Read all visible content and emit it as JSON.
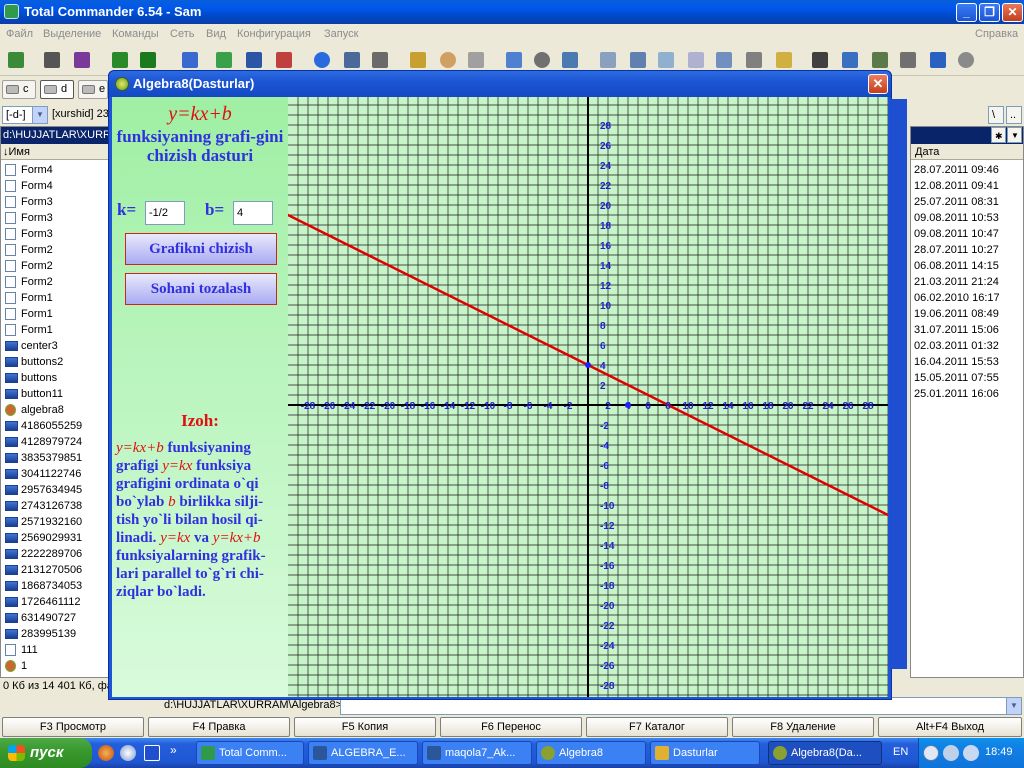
{
  "tc": {
    "title": "Total Commander 6.54 - Sam",
    "menu": [
      "Файл",
      "Выделение",
      "Команды",
      "Сеть",
      "Вид",
      "Конфигурация",
      "Запуск"
    ],
    "menu_right": "Справка",
    "drives_left": [
      "c",
      "d",
      "e"
    ],
    "drive_combo": "[-d-]",
    "drive_label": "[xurshid]  23",
    "left_path": "d:\\HUJJATLAR\\XURRA",
    "left_col_name": "↓Имя",
    "files": [
      {
        "name": "Form4",
        "icon": "file-icon"
      },
      {
        "name": "Form4",
        "icon": "file-icon"
      },
      {
        "name": "Form3",
        "icon": "file-icon"
      },
      {
        "name": "Form3",
        "icon": "file-icon"
      },
      {
        "name": "Form3",
        "icon": "file-icon"
      },
      {
        "name": "Form2",
        "icon": "file-icon"
      },
      {
        "name": "Form2",
        "icon": "file-icon"
      },
      {
        "name": "Form2",
        "icon": "file-icon"
      },
      {
        "name": "Form1",
        "icon": "file-icon"
      },
      {
        "name": "Form1",
        "icon": "file-icon"
      },
      {
        "name": "Form1",
        "icon": "file-icon"
      },
      {
        "name": "center3",
        "icon": "exe-icon"
      },
      {
        "name": "buttons2",
        "icon": "exe-icon"
      },
      {
        "name": "buttons",
        "icon": "exe-icon"
      },
      {
        "name": "button11",
        "icon": "exe-icon"
      },
      {
        "name": "algebra8",
        "icon": "gear-icon"
      },
      {
        "name": "4186055259",
        "icon": "exe-icon"
      },
      {
        "name": "4128979724",
        "icon": "exe-icon"
      },
      {
        "name": "3835379851",
        "icon": "exe-icon"
      },
      {
        "name": "3041122746",
        "icon": "exe-icon"
      },
      {
        "name": "2957634945",
        "icon": "exe-icon"
      },
      {
        "name": "2743126738",
        "icon": "exe-icon"
      },
      {
        "name": "2571932160",
        "icon": "exe-icon"
      },
      {
        "name": "2569029931",
        "icon": "exe-icon"
      },
      {
        "name": "2222289706",
        "icon": "exe-icon"
      },
      {
        "name": "2131270506",
        "icon": "exe-icon"
      },
      {
        "name": "1868734053",
        "icon": "exe-icon"
      },
      {
        "name": "1726461112",
        "icon": "exe-icon"
      },
      {
        "name": "631490727",
        "icon": "exe-icon"
      },
      {
        "name": "283995139",
        "icon": "exe-icon"
      },
      {
        "name": "111",
        "icon": "file-icon"
      },
      {
        "name": "1",
        "icon": "gear-icon"
      }
    ],
    "left_status": "0 Кб из 14 401 Кб, фа",
    "right_col_date": "Дата",
    "dates": [
      "28.07.2011 09:46",
      "12.08.2011 09:41",
      "25.07.2011 08:31",
      "09.08.2011 10:53",
      "09.08.2011 10:47",
      "28.07.2011 10:27",
      "06.08.2011 14:15",
      "21.03.2011 21:24",
      "06.02.2010 16:17",
      "19.06.2011 08:49",
      "31.07.2011 15:06",
      "02.03.2011 01:32",
      "16.04.2011 15:53",
      "15.05.2011 07:55",
      "25.01.2011 16:06"
    ],
    "cmd_path": "d:\\HUJJATLAR\\XURRAM\\Algebra8>",
    "fkeys": [
      "F3 Просмотр",
      "F4 Правка",
      "F5 Копия",
      "F6 Перенос",
      "F7 Каталог",
      "F8 Удаление",
      "Alt+F4 Выход"
    ]
  },
  "dialog": {
    "title": "Algebra8(Dasturlar)",
    "formula": "y=kx+b",
    "subtitle": "funksiyaning grafi-gini chizish dasturi",
    "k_label": "k=",
    "k_value": "-1/2",
    "b_label": "b=",
    "b_value": "4",
    "draw_button": "Grafikni chizish",
    "clear_button": "Sohani tozalash",
    "izoh": "Izoh:",
    "note": [
      {
        "t": "y=kx+b",
        "red": true
      },
      {
        "t": "  funksiyaning grafigi  ",
        "red": false
      },
      {
        "t": "y=kx",
        "red": true
      },
      {
        "t": "  funksiya grafigini ordinata o`qi bo`ylab ",
        "red": false
      },
      {
        "t": "b",
        "red": true
      },
      {
        "t": " birlikka silji-tish yo`li bilan hosil qi-linadi.  ",
        "red": false
      },
      {
        "t": "y=kx",
        "red": true
      },
      {
        "t": " va  ",
        "red": false
      },
      {
        "t": "y=kx+b",
        "red": true
      },
      {
        "t": " funksiyalarning grafik-lari parallel to`g`ri chi-ziqlar bo`ladi.",
        "red": false
      }
    ]
  },
  "chart_data": {
    "type": "line",
    "xlim": [
      -29,
      30
    ],
    "ylim": [
      -30,
      30
    ],
    "x_ticks": [
      -28,
      -26,
      -24,
      -22,
      -20,
      -18,
      -16,
      -14,
      -12,
      -10,
      -8,
      -6,
      -4,
      -2,
      2,
      4,
      6,
      8,
      10,
      12,
      14,
      16,
      18,
      20,
      22,
      24,
      26,
      28
    ],
    "y_ticks": [
      28,
      26,
      24,
      22,
      20,
      18,
      16,
      14,
      12,
      10,
      8,
      6,
      4,
      2,
      -2,
      -4,
      -6,
      -8,
      -10,
      -12,
      -14,
      -16,
      -18,
      -20,
      -22,
      -24,
      -26,
      -28
    ],
    "grid": true,
    "series": [
      {
        "k": -0.5,
        "b": 4,
        "color": "#e00000"
      }
    ],
    "points": [
      {
        "x": 0,
        "y": 4
      },
      {
        "x": 4,
        "y": 0
      }
    ]
  },
  "colors": {
    "plot_bg": "#c6f3c8",
    "grid": "#1a1a1a",
    "line": "#e00000",
    "tick": "#2020d0",
    "point": "#2020ff"
  },
  "taskbar": {
    "start": "пуск",
    "tasks": [
      "Total Comm...",
      "ALGEBRA_E...",
      "maqola7_Ak...",
      "Algebra8",
      "Dasturlar",
      "Algebra8(Da..."
    ],
    "lang": "EN",
    "clock": "18:49"
  }
}
